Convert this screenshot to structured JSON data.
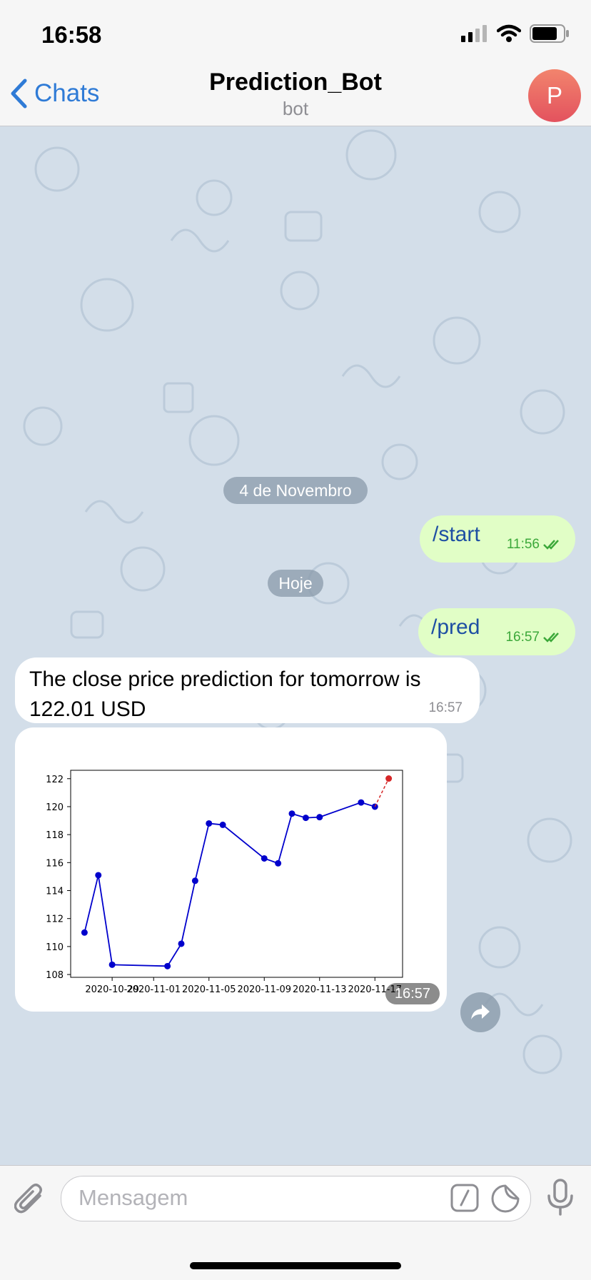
{
  "status": {
    "time": "16:58"
  },
  "header": {
    "back_label": "Chats",
    "title": "Prediction_Bot",
    "subtitle": "bot",
    "avatar_letter": "P"
  },
  "messages": {
    "date1": "4 de Novembro",
    "start": {
      "text": "/start",
      "time": "11:56"
    },
    "date2": "Hoje",
    "pred": {
      "text": "/pred",
      "time": "16:57"
    },
    "reply": {
      "text": "The close price prediction for tomorrow is 122.01 USD",
      "time": "16:57"
    },
    "image_time": "16:57"
  },
  "input": {
    "placeholder": "Mensagem"
  },
  "colors": {
    "accent": "#2f7bd6",
    "outgoing": "#e1fec6",
    "series": "#0000cc",
    "prediction": "#d62728"
  },
  "chart_data": {
    "type": "line",
    "x": [
      "2020-10-27",
      "2020-10-28",
      "2020-10-29",
      "2020-11-02",
      "2020-11-03",
      "2020-11-04",
      "2020-11-05",
      "2020-11-06",
      "2020-11-09",
      "2020-11-10",
      "2020-11-11",
      "2020-11-12",
      "2020-11-13",
      "2020-11-16",
      "2020-11-17"
    ],
    "series": [
      {
        "values": [
          111.0,
          115.1,
          108.7,
          108.6,
          110.2,
          114.7,
          118.8,
          118.7,
          116.3,
          115.95,
          119.5,
          119.2,
          119.25,
          120.3,
          120.0
        ]
      }
    ],
    "prediction": {
      "x": [
        "2020-11-17",
        "2020-11-18"
      ],
      "values": [
        120.0,
        122.01
      ]
    },
    "xticks": [
      "2020-10-29",
      "2020-11-01",
      "2020-11-05",
      "2020-11-09",
      "2020-11-13",
      "2020-11-17"
    ],
    "yticks": [
      108,
      110,
      112,
      114,
      116,
      118,
      120,
      122
    ],
    "ylim": [
      107.8,
      122.6
    ],
    "xlim": [
      "2020-10-26",
      "2020-11-19"
    ],
    "title": "",
    "xlabel": "",
    "ylabel": "",
    "grid": false
  }
}
